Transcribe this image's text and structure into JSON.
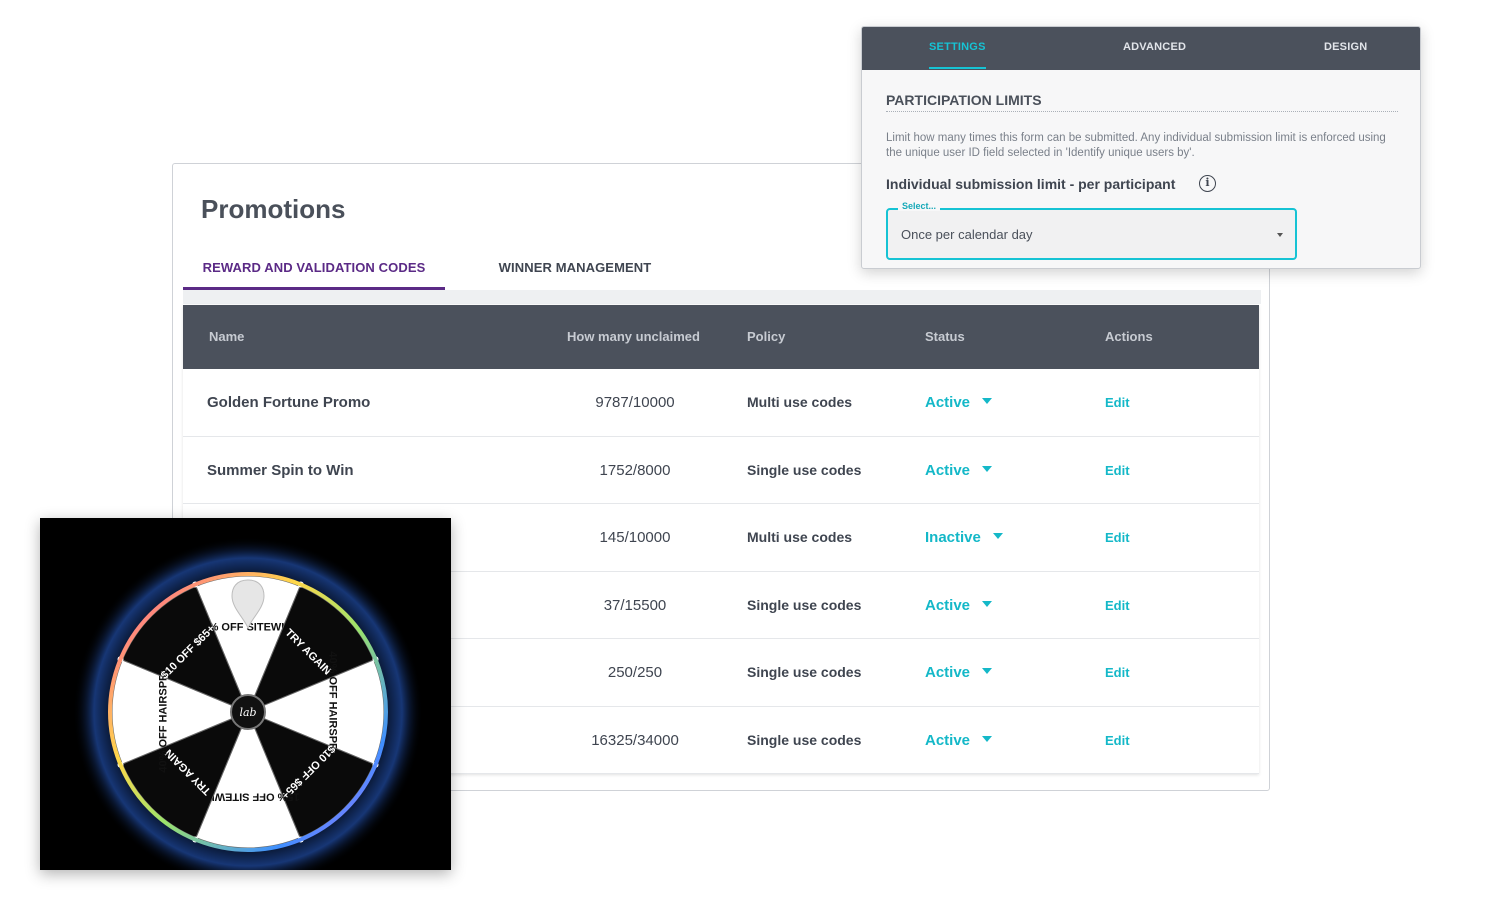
{
  "promotions": {
    "title": "Promotions",
    "tabs": [
      {
        "label": "REWARD AND VALIDATION CODES",
        "active": true
      },
      {
        "label": "WINNER MANAGEMENT",
        "active": false
      }
    ],
    "columns": {
      "name": "Name",
      "unclaimed": "How many unclaimed",
      "policy": "Policy",
      "status": "Status",
      "actions": "Actions"
    },
    "rows": [
      {
        "name": "Golden Fortune Promo",
        "unclaimed": "9787/10000",
        "policy": "Multi use codes",
        "status": "Active",
        "action": "Edit"
      },
      {
        "name": "Summer Spin to Win",
        "unclaimed": "1752/8000",
        "policy": "Single use codes",
        "status": "Active",
        "action": "Edit"
      },
      {
        "name": "",
        "unclaimed": "145/10000",
        "policy": "Multi use codes",
        "status": "Inactive",
        "action": "Edit"
      },
      {
        "name": "",
        "unclaimed": "37/15500",
        "policy": "Single use codes",
        "status": "Active",
        "action": "Edit"
      },
      {
        "name": "",
        "unclaimed": "250/250",
        "policy": "Single use codes",
        "status": "Active",
        "action": "Edit"
      },
      {
        "name": "",
        "unclaimed": "16325/34000",
        "policy": "Single use codes",
        "status": "Active",
        "action": "Edit"
      }
    ]
  },
  "settings": {
    "tabs": [
      {
        "label": "SETTINGS",
        "active": true
      },
      {
        "label": "ADVANCED",
        "active": false
      },
      {
        "label": "DESIGN",
        "active": false
      }
    ],
    "section_title": "PARTICIPATION LIMITS",
    "description": "Limit how many times this form can be submitted. Any individual submission limit is enforced using the unique user ID field selected in 'Identify unique users by'.",
    "field_label": "Individual submission limit - per participant",
    "info_glyph": "i",
    "select_legend": "Select...",
    "select_value": "Once per calendar day"
  },
  "wheel": {
    "segments": [
      "15% OFF SITEWIDE",
      "TRY AGAIN",
      "40% OFF HAIRSPRAYS",
      "$10 OFF $65+",
      "15% OFF SITEWIDE",
      "TRY AGAIN",
      "40% OFF HAIRSPRAYS",
      "$10 OFF $65+"
    ],
    "center_logo": "lab"
  },
  "colors": {
    "accent": "#14b8c8",
    "tab_active": "#5b2a86",
    "header_bg": "#4b515c"
  }
}
